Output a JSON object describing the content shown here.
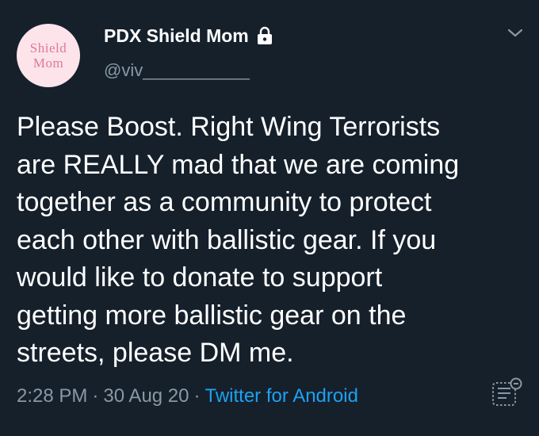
{
  "user": {
    "avatar_text_line1": "Shield",
    "avatar_text_line2": "Mom",
    "display_name": "PDX Shield Mom",
    "handle": "@viv___________",
    "protected_icon": "lock-icon"
  },
  "tweet": {
    "lines": [
      "Please Boost. Right Wing Terrorists",
      "are REALLY mad that we are coming",
      "together as a community to protect",
      "each other with ballistic gear. If you",
      "would like to donate to support",
      "getting more ballistic gear on the",
      "streets, please DM me."
    ]
  },
  "meta": {
    "time": "2:28 PM",
    "separator": "·",
    "date": "30 Aug 20",
    "source": "Twitter for Android"
  },
  "icons": {
    "menu": "chevron-down-icon",
    "analytics": "analytics-icon"
  },
  "colors": {
    "background": "#15202b",
    "text": "#ffffff",
    "secondary": "#8899a6",
    "link": "#1da1f2",
    "avatar_bg": "#fce4ea",
    "avatar_text": "#e07898"
  }
}
